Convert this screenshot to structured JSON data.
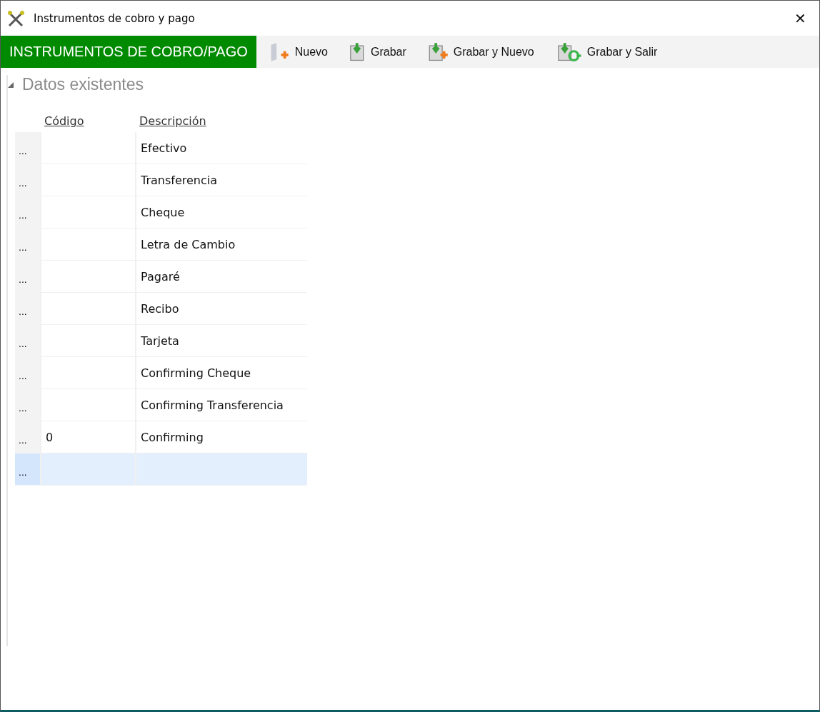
{
  "window": {
    "title": "Instrumentos de cobro y pago",
    "close": "✕"
  },
  "toolbar": {
    "heading": "INSTRUMENTOS DE COBRO/PAGO",
    "buttons": [
      {
        "label": "Nuevo",
        "kind": "new"
      },
      {
        "label": "Grabar",
        "kind": "save"
      },
      {
        "label": "Grabar y Nuevo",
        "kind": "save-new"
      },
      {
        "label": "Grabar y Salir",
        "kind": "save-exit"
      }
    ]
  },
  "section": {
    "title": "Datos existentes",
    "expanded": true
  },
  "table": {
    "columns": [
      "Código",
      "Descripción"
    ],
    "rows": [
      {
        "handle": "...",
        "cells": [
          "",
          "Efectivo"
        ],
        "selected": false
      },
      {
        "handle": "...",
        "cells": [
          "",
          "Transferencia"
        ],
        "selected": false
      },
      {
        "handle": "...",
        "cells": [
          "",
          "Cheque"
        ],
        "selected": false
      },
      {
        "handle": "...",
        "cells": [
          "",
          "Letra de Cambio"
        ],
        "selected": false
      },
      {
        "handle": "...",
        "cells": [
          "",
          "Pagaré"
        ],
        "selected": false
      },
      {
        "handle": "...",
        "cells": [
          "",
          "Recibo"
        ],
        "selected": false
      },
      {
        "handle": "...",
        "cells": [
          "",
          "Tarjeta"
        ],
        "selected": false
      },
      {
        "handle": "...",
        "cells": [
          "",
          "Confirming Cheque"
        ],
        "selected": false
      },
      {
        "handle": "...",
        "cells": [
          "",
          "Confirming Transferencia"
        ],
        "selected": false
      },
      {
        "handle": "...",
        "cells": [
          "0",
          "Confirming"
        ],
        "selected": false
      },
      {
        "handle": "...",
        "cells": [
          "",
          ""
        ],
        "selected": true
      }
    ]
  }
}
